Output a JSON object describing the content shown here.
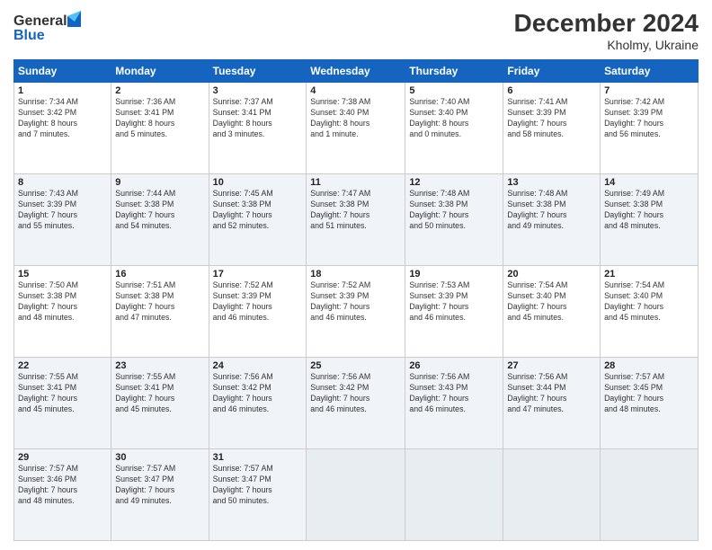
{
  "header": {
    "logo_line1": "General",
    "logo_line2": "Blue",
    "title": "December 2024",
    "subtitle": "Kholmy, Ukraine"
  },
  "columns": [
    "Sunday",
    "Monday",
    "Tuesday",
    "Wednesday",
    "Thursday",
    "Friday",
    "Saturday"
  ],
  "weeks": [
    [
      {
        "day": "1",
        "info": "Sunrise: 7:34 AM\nSunset: 3:42 PM\nDaylight: 8 hours\nand 7 minutes."
      },
      {
        "day": "2",
        "info": "Sunrise: 7:36 AM\nSunset: 3:41 PM\nDaylight: 8 hours\nand 5 minutes."
      },
      {
        "day": "3",
        "info": "Sunrise: 7:37 AM\nSunset: 3:41 PM\nDaylight: 8 hours\nand 3 minutes."
      },
      {
        "day": "4",
        "info": "Sunrise: 7:38 AM\nSunset: 3:40 PM\nDaylight: 8 hours\nand 1 minute."
      },
      {
        "day": "5",
        "info": "Sunrise: 7:40 AM\nSunset: 3:40 PM\nDaylight: 8 hours\nand 0 minutes."
      },
      {
        "day": "6",
        "info": "Sunrise: 7:41 AM\nSunset: 3:39 PM\nDaylight: 7 hours\nand 58 minutes."
      },
      {
        "day": "7",
        "info": "Sunrise: 7:42 AM\nSunset: 3:39 PM\nDaylight: 7 hours\nand 56 minutes."
      }
    ],
    [
      {
        "day": "8",
        "info": "Sunrise: 7:43 AM\nSunset: 3:39 PM\nDaylight: 7 hours\nand 55 minutes."
      },
      {
        "day": "9",
        "info": "Sunrise: 7:44 AM\nSunset: 3:38 PM\nDaylight: 7 hours\nand 54 minutes."
      },
      {
        "day": "10",
        "info": "Sunrise: 7:45 AM\nSunset: 3:38 PM\nDaylight: 7 hours\nand 52 minutes."
      },
      {
        "day": "11",
        "info": "Sunrise: 7:47 AM\nSunset: 3:38 PM\nDaylight: 7 hours\nand 51 minutes."
      },
      {
        "day": "12",
        "info": "Sunrise: 7:48 AM\nSunset: 3:38 PM\nDaylight: 7 hours\nand 50 minutes."
      },
      {
        "day": "13",
        "info": "Sunrise: 7:48 AM\nSunset: 3:38 PM\nDaylight: 7 hours\nand 49 minutes."
      },
      {
        "day": "14",
        "info": "Sunrise: 7:49 AM\nSunset: 3:38 PM\nDaylight: 7 hours\nand 48 minutes."
      }
    ],
    [
      {
        "day": "15",
        "info": "Sunrise: 7:50 AM\nSunset: 3:38 PM\nDaylight: 7 hours\nand 48 minutes."
      },
      {
        "day": "16",
        "info": "Sunrise: 7:51 AM\nSunset: 3:38 PM\nDaylight: 7 hours\nand 47 minutes."
      },
      {
        "day": "17",
        "info": "Sunrise: 7:52 AM\nSunset: 3:39 PM\nDaylight: 7 hours\nand 46 minutes."
      },
      {
        "day": "18",
        "info": "Sunrise: 7:52 AM\nSunset: 3:39 PM\nDaylight: 7 hours\nand 46 minutes."
      },
      {
        "day": "19",
        "info": "Sunrise: 7:53 AM\nSunset: 3:39 PM\nDaylight: 7 hours\nand 46 minutes."
      },
      {
        "day": "20",
        "info": "Sunrise: 7:54 AM\nSunset: 3:40 PM\nDaylight: 7 hours\nand 45 minutes."
      },
      {
        "day": "21",
        "info": "Sunrise: 7:54 AM\nSunset: 3:40 PM\nDaylight: 7 hours\nand 45 minutes."
      }
    ],
    [
      {
        "day": "22",
        "info": "Sunrise: 7:55 AM\nSunset: 3:41 PM\nDaylight: 7 hours\nand 45 minutes."
      },
      {
        "day": "23",
        "info": "Sunrise: 7:55 AM\nSunset: 3:41 PM\nDaylight: 7 hours\nand 45 minutes."
      },
      {
        "day": "24",
        "info": "Sunrise: 7:56 AM\nSunset: 3:42 PM\nDaylight: 7 hours\nand 46 minutes."
      },
      {
        "day": "25",
        "info": "Sunrise: 7:56 AM\nSunset: 3:42 PM\nDaylight: 7 hours\nand 46 minutes."
      },
      {
        "day": "26",
        "info": "Sunrise: 7:56 AM\nSunset: 3:43 PM\nDaylight: 7 hours\nand 46 minutes."
      },
      {
        "day": "27",
        "info": "Sunrise: 7:56 AM\nSunset: 3:44 PM\nDaylight: 7 hours\nand 47 minutes."
      },
      {
        "day": "28",
        "info": "Sunrise: 7:57 AM\nSunset: 3:45 PM\nDaylight: 7 hours\nand 48 minutes."
      }
    ],
    [
      {
        "day": "29",
        "info": "Sunrise: 7:57 AM\nSunset: 3:46 PM\nDaylight: 7 hours\nand 48 minutes."
      },
      {
        "day": "30",
        "info": "Sunrise: 7:57 AM\nSunset: 3:47 PM\nDaylight: 7 hours\nand 49 minutes."
      },
      {
        "day": "31",
        "info": "Sunrise: 7:57 AM\nSunset: 3:47 PM\nDaylight: 7 hours\nand 50 minutes."
      },
      {
        "day": "",
        "info": ""
      },
      {
        "day": "",
        "info": ""
      },
      {
        "day": "",
        "info": ""
      },
      {
        "day": "",
        "info": ""
      }
    ]
  ]
}
